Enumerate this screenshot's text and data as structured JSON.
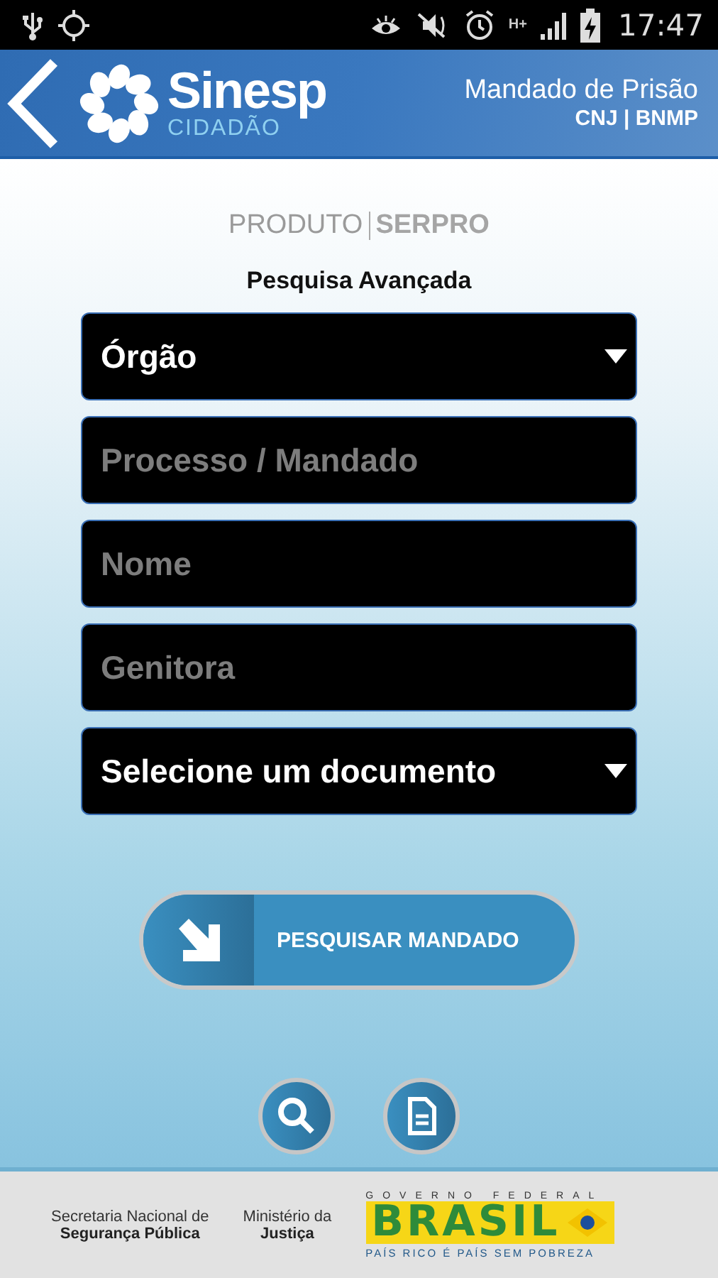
{
  "status_bar": {
    "network": "H+",
    "time": "17:47"
  },
  "header": {
    "logo": "Sinesp",
    "logo_sub": "CIDADÃO",
    "title": "Mandado de Prisão",
    "subtitle": "CNJ | BNMP"
  },
  "credit": {
    "prefix": "PRODUTO",
    "brand": "SERPRO"
  },
  "section_title": "Pesquisa Avançada",
  "fields": [
    {
      "kind": "dropdown",
      "value": "Órgão"
    },
    {
      "kind": "text",
      "placeholder": "Processo / Mandado"
    },
    {
      "kind": "text",
      "placeholder": "Nome"
    },
    {
      "kind": "text",
      "placeholder": "Genitora"
    },
    {
      "kind": "dropdown",
      "value": "Selecione um documento"
    }
  ],
  "search_button": {
    "label": "PESQUISAR MANDADO"
  },
  "footer": {
    "secretariat": [
      "Secretaria Nacional de",
      "Segurança Pública"
    ],
    "ministry": [
      "Ministério da",
      "Justiça"
    ],
    "government": {
      "top": "GOVERNO FEDERAL",
      "name": "BRASIL",
      "motto": "PAÍS RICO É PAÍS SEM POBREZA"
    }
  }
}
